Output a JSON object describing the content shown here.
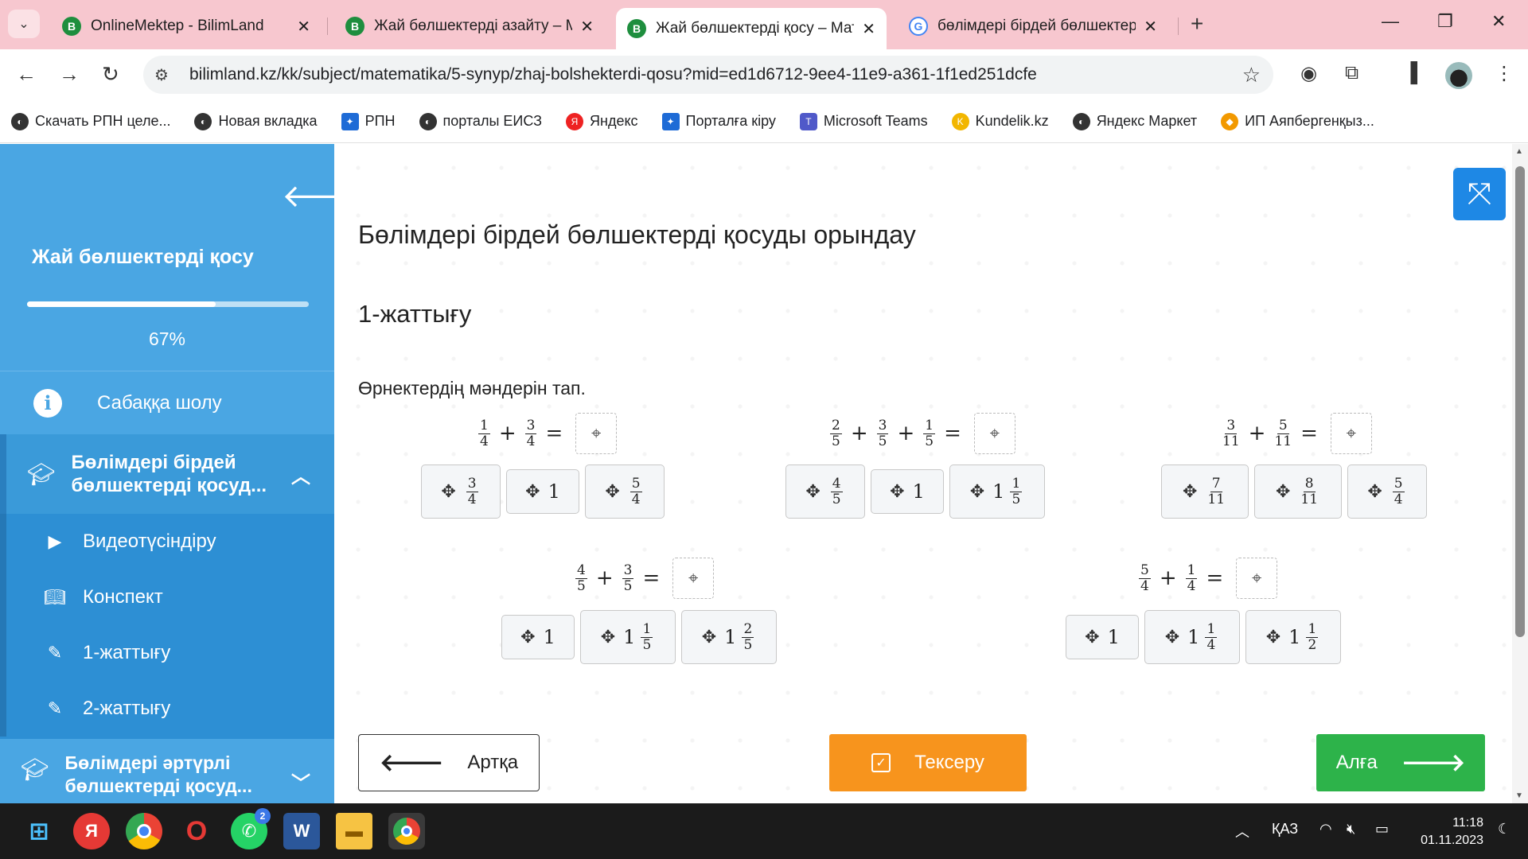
{
  "browser": {
    "tabs": [
      {
        "title": "OnlineMektep - BilimLand",
        "favicon": "B"
      },
      {
        "title": "Жай бөлшектерді азайту – Ма",
        "favicon": "B"
      },
      {
        "title": "Жай бөлшектерді қосу – Мат",
        "favicon": "B",
        "active": true
      },
      {
        "title": "бөлімдері бірдей бөлшектерд",
        "favicon": "G"
      }
    ],
    "url": "bilimland.kz/kk/subject/matematika/5-synyp/zhaj-bolshekterdi-qosu?mid=ed1d6712-9ee4-11e9-a361-1f1ed251dcfe",
    "bookmarks": [
      "Скачать РПН целе...",
      "Новая вкладка",
      "РПН",
      "порталы ЕИСЗ",
      "Яндекс",
      "Порталға кіру",
      "Microsoft Teams",
      "Kundelik.kz",
      "Яндекс Маркет",
      "ИП Аяпбергенқыз..."
    ]
  },
  "sidebar": {
    "course_title": "Жай бөлшектерді қосу",
    "progress_percent": 67,
    "progress_label": "67%",
    "overview": "Сабаққа шолу",
    "section_active": "Бөлімдері бірдей бөлшектерді қосуд...",
    "items": [
      "Видеотүсіндіру",
      "Конспект",
      "1-жаттығу",
      "2-жаттығу"
    ],
    "section_next": "Бөлімдері әртүрлі бөлшектерді қосуд..."
  },
  "content": {
    "title": "Бөлімдері бірдей бөлшектерді қосуды орындау",
    "exercise": "1-жаттығу",
    "instruction": "Өрнектердің мәндерін тап."
  },
  "exercises": [
    {
      "terms": [
        {
          "n": "1",
          "d": "4"
        },
        {
          "n": "3",
          "d": "4"
        }
      ],
      "options": [
        {
          "n": "3",
          "d": "4"
        },
        {
          "w": "1"
        },
        {
          "n": "5",
          "d": "4"
        }
      ]
    },
    {
      "terms": [
        {
          "n": "2",
          "d": "5"
        },
        {
          "n": "3",
          "d": "5"
        },
        {
          "n": "1",
          "d": "5"
        }
      ],
      "options": [
        {
          "n": "4",
          "d": "5"
        },
        {
          "w": "1"
        },
        {
          "w": "1",
          "n": "1",
          "d": "5"
        }
      ]
    },
    {
      "terms": [
        {
          "n": "3",
          "d": "11"
        },
        {
          "n": "5",
          "d": "11"
        }
      ],
      "options": [
        {
          "n": "7",
          "d": "11"
        },
        {
          "n": "8",
          "d": "11"
        },
        {
          "n": "5",
          "d": "4"
        }
      ]
    },
    {
      "terms": [
        {
          "n": "4",
          "d": "5"
        },
        {
          "n": "3",
          "d": "5"
        }
      ],
      "options": [
        {
          "w": "1"
        },
        {
          "w": "1",
          "n": "1",
          "d": "5"
        },
        {
          "w": "1",
          "n": "2",
          "d": "5"
        }
      ]
    },
    {
      "terms": [
        {
          "n": "5",
          "d": "4"
        },
        {
          "n": "1",
          "d": "4"
        }
      ],
      "options": [
        {
          "w": "1"
        },
        {
          "w": "1",
          "n": "1",
          "d": "4"
        },
        {
          "w": "1",
          "n": "1",
          "d": "2"
        }
      ]
    }
  ],
  "buttons": {
    "back": "Артқа",
    "check": "Тексеру",
    "next": "Алға"
  },
  "taskbar": {
    "whatsapp_badge": "2",
    "language": "ҚАЗ",
    "time": "11:18",
    "date": "01.11.2023"
  },
  "colors": {
    "tabbar": "#f7c7cf",
    "sidebar": "#2d8fd4",
    "sidebar_head": "#4aa6e3",
    "check_button": "#f7941d",
    "next_button": "#2db34a",
    "fullscreen_button": "#1e88e5"
  }
}
